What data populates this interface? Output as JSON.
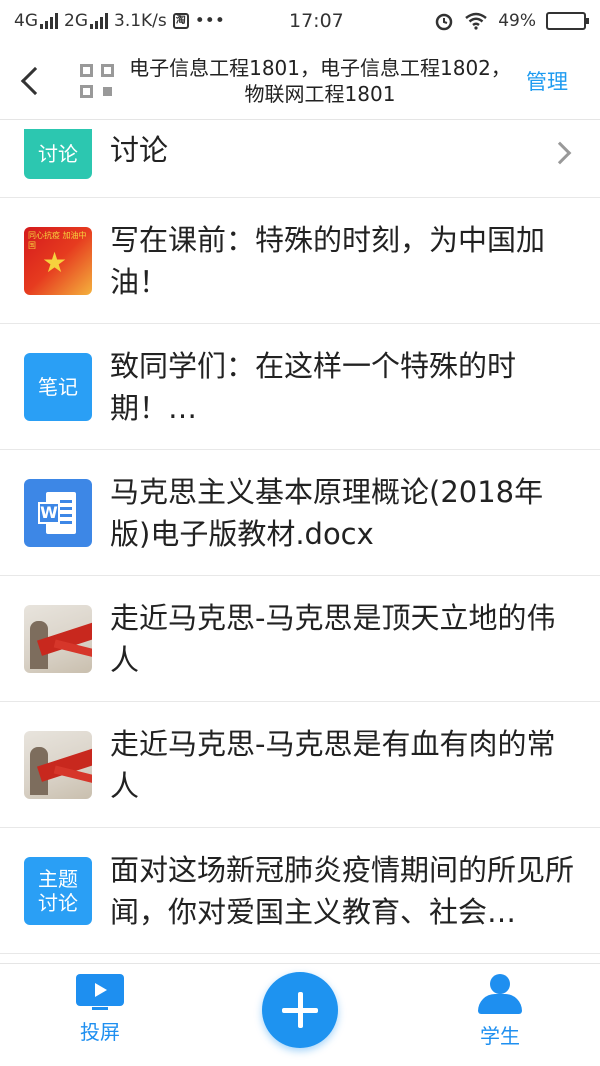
{
  "status_bar": {
    "network1": "4G",
    "network2": "2G",
    "speed": "3.1K/s",
    "app_badge": "淘",
    "dots": "•••",
    "time": "17:07",
    "battery": "49%",
    "battery_level": 0.49
  },
  "header": {
    "title": "电子信息工程1801，电子信息工程1802，物联网工程1801",
    "manage_label": "管理"
  },
  "list": {
    "items": [
      {
        "icon_label": "讨论",
        "title": "讨论",
        "kind": "discussion"
      },
      {
        "icon_label": "",
        "icon_caption": "同心抗疫 加油中国",
        "title": "写在课前：特殊的时刻，为中国加油！",
        "kind": "image"
      },
      {
        "icon_label": "笔记",
        "title": "致同学们：在这样一个特殊的时期！…",
        "kind": "note"
      },
      {
        "icon_label": "W",
        "title": "马克思主义基本原理概论(2018年版)电子版教材.docx",
        "kind": "word-doc"
      },
      {
        "icon_label": "",
        "title": "走近马克思-马克思是顶天立地的伟人",
        "kind": "video"
      },
      {
        "icon_label": "",
        "title": "走近马克思-马克思是有血有肉的常人",
        "kind": "video"
      },
      {
        "icon_label": "主题讨论",
        "title": "面对这场新冠肺炎疫情期间的所见所闻，你对爱国主义教育、社会…",
        "kind": "topic-discussion"
      }
    ]
  },
  "bottom_bar": {
    "cast_label": "投屏",
    "students_label": "学生"
  },
  "colors": {
    "accent": "#1e8ff0",
    "teal": "#2cc7b0",
    "note_blue": "#2a9ff5",
    "word_blue": "#3d87e6"
  }
}
